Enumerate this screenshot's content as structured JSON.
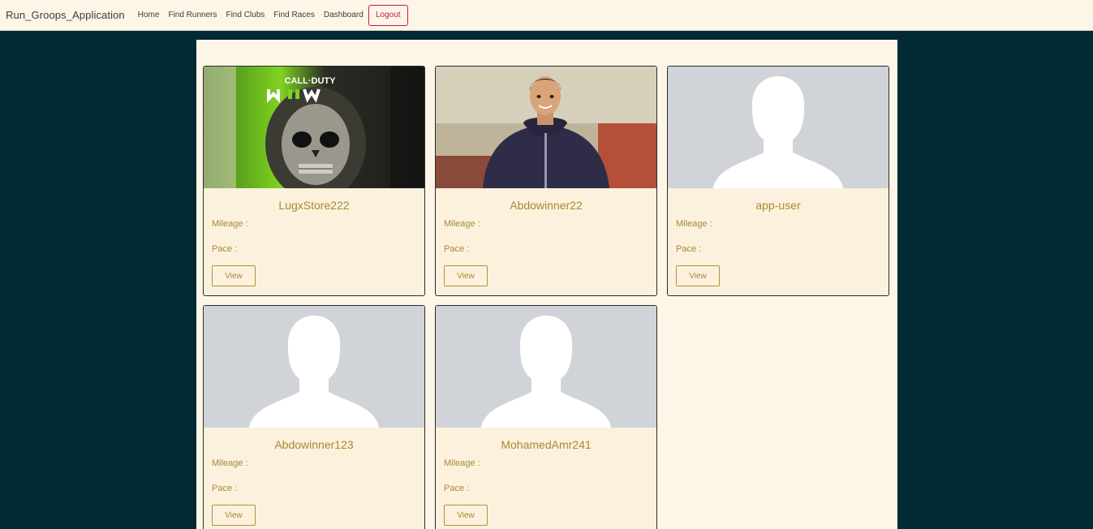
{
  "navbar": {
    "brand": "Run_Groops_Application",
    "links": [
      "Home",
      "Find Runners",
      "Find Clubs",
      "Find Races",
      "Dashboard"
    ],
    "logout_label": "Logout"
  },
  "cards": [
    {
      "name": "LugxStore222",
      "mileage_label": "Mileage :",
      "pace_label": "Pace :",
      "view_label": "View",
      "image": "game-cover",
      "image_text": "CALL·DUTY"
    },
    {
      "name": "Abdowinner22",
      "mileage_label": "Mileage :",
      "pace_label": "Pace :",
      "view_label": "View",
      "image": "person-photo"
    },
    {
      "name": "app-user",
      "mileage_label": "Mileage :",
      "pace_label": "Pace :",
      "view_label": "View",
      "image": "avatar-placeholder"
    },
    {
      "name": "Abdowinner123",
      "mileage_label": "Mileage :",
      "pace_label": "Pace :",
      "view_label": "View",
      "image": "avatar-placeholder"
    },
    {
      "name": "MohamedAmr241",
      "mileage_label": "Mileage :",
      "pace_label": "Pace :",
      "view_label": "View",
      "image": "avatar-placeholder"
    }
  ],
  "colors": {
    "background": "#012a35",
    "navbar": "#fdf6e6",
    "card_text": "#a98935",
    "logout": "#c2185b"
  }
}
